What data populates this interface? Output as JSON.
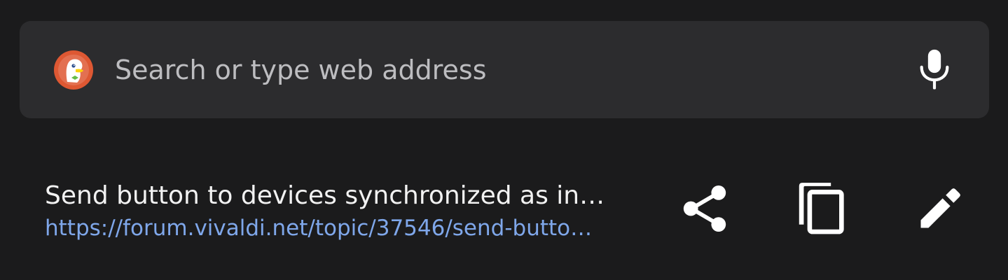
{
  "search": {
    "placeholder": "Search or type web address",
    "engine_icon": "duckduckgo-icon",
    "voice_icon": "microphone-icon"
  },
  "suggestion": {
    "title": "Send button to devices synchronized as in…",
    "url": "https://forum.vivaldi.net/topic/37546/send-butto…",
    "actions": {
      "share_icon": "share-icon",
      "copy_icon": "copy-icon",
      "edit_icon": "pencil-icon"
    }
  },
  "colors": {
    "background": "#1b1b1c",
    "search_bar": "#2c2c2e",
    "url_link": "#7fa7ea",
    "title_text": "#f2f2f2",
    "duckduckgo_orange": "#de5833"
  }
}
